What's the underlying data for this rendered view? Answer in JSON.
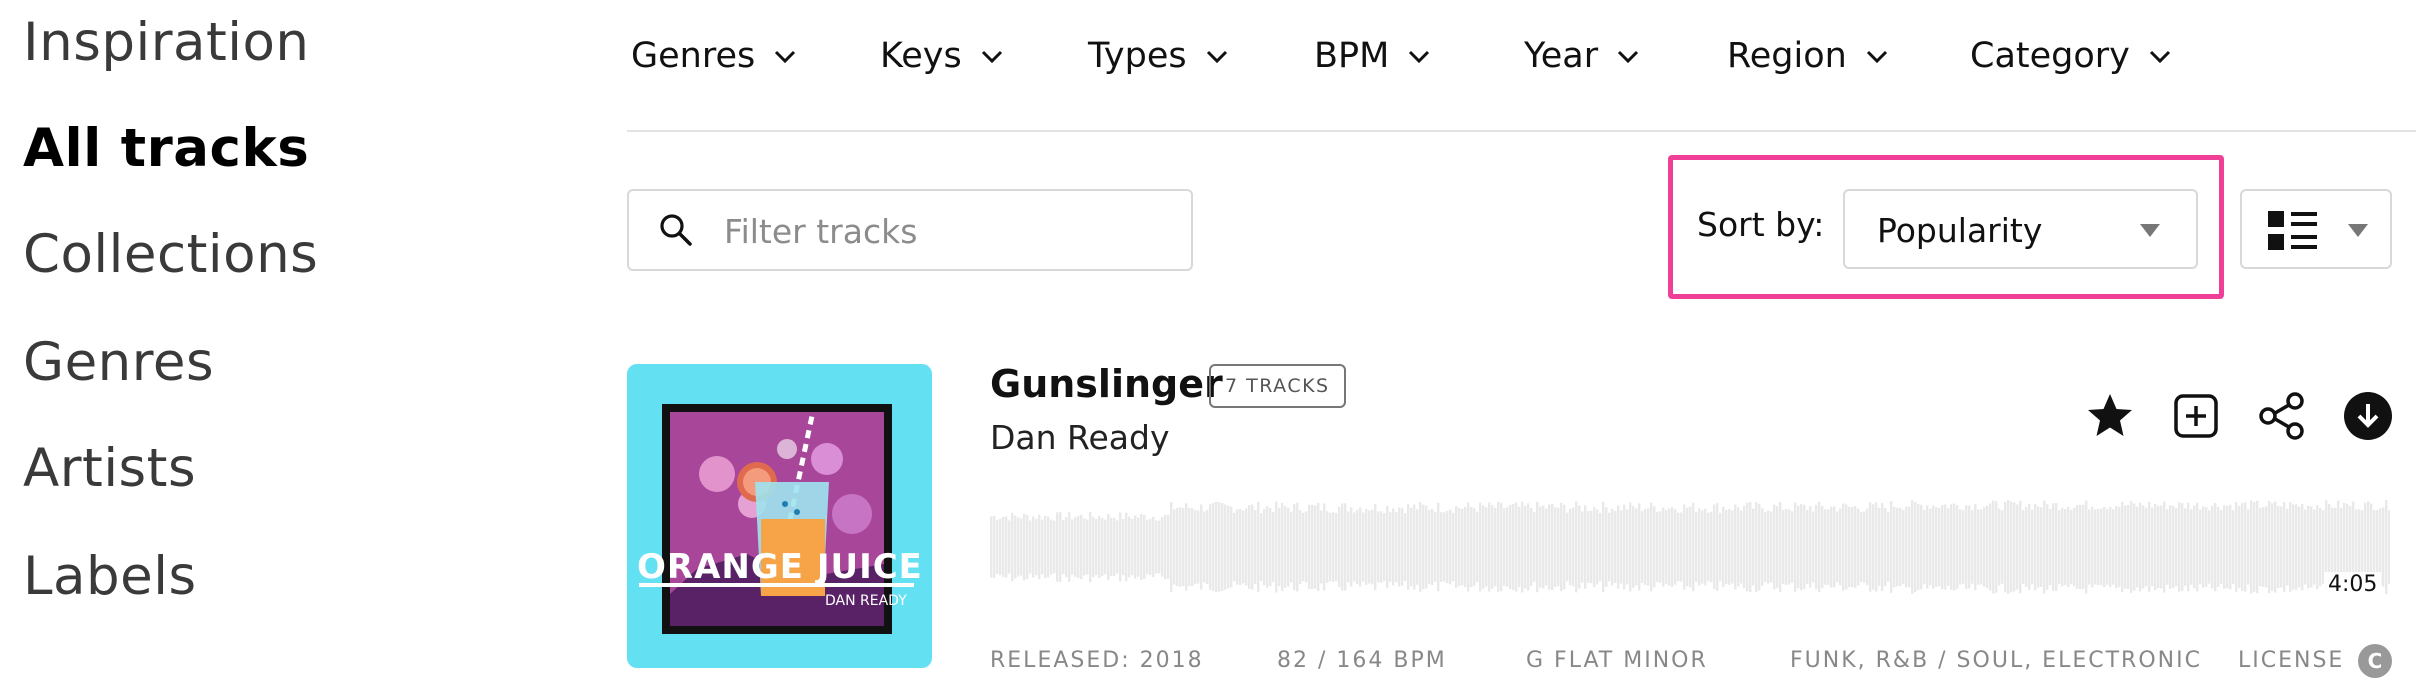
{
  "sidebar": {
    "items": [
      {
        "label": "Inspiration",
        "active": false
      },
      {
        "label": "All tracks",
        "active": true
      },
      {
        "label": "Collections",
        "active": false
      },
      {
        "label": "Genres",
        "active": false
      },
      {
        "label": "Artists",
        "active": false
      },
      {
        "label": "Labels",
        "active": false
      }
    ]
  },
  "filters": [
    {
      "label": "Genres",
      "icon": "chevron-down-icon"
    },
    {
      "label": "Keys",
      "icon": "chevron-down-icon"
    },
    {
      "label": "Types",
      "icon": "chevron-down-icon"
    },
    {
      "label": "BPM",
      "icon": "chevron-down-icon"
    },
    {
      "label": "Year",
      "icon": "chevron-down-icon"
    },
    {
      "label": "Region",
      "icon": "chevron-down-icon"
    },
    {
      "label": "Category",
      "icon": "chevron-down-icon"
    }
  ],
  "search": {
    "placeholder": "Filter tracks",
    "value": "",
    "icon": "search-icon"
  },
  "sort": {
    "label": "Sort by:",
    "selected": "Popularity",
    "highlight_color": "#ef3f97"
  },
  "view_toggle": {
    "icon": "list-view-icon"
  },
  "track": {
    "title": "Gunslinger",
    "badge": "7 TRACKS",
    "artist": "Dan Ready",
    "cover": {
      "title": "ORANGE JUICE",
      "artist": "DAN READY",
      "bg_color": "#63e1f2",
      "frame_color": "#a8469a"
    },
    "actions": [
      {
        "name": "favorite-star-icon"
      },
      {
        "name": "add-to-playlist-icon"
      },
      {
        "name": "share-icon"
      },
      {
        "name": "download-icon"
      }
    ],
    "duration": "4:05",
    "meta": {
      "released": "RELEASED: 2018",
      "bpm": "82 / 164 BPM",
      "key": "G FLAT MINOR",
      "genres": "FUNK, R&B / SOUL, ELECTRONIC",
      "license": "LICENSE",
      "license_icon": "C"
    }
  }
}
